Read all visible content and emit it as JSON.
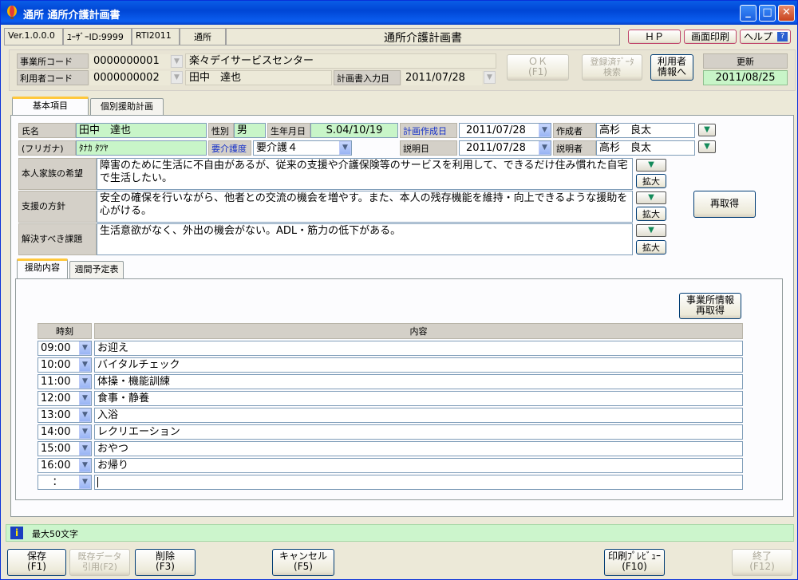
{
  "window": {
    "title": "通所 通所介護計画書"
  },
  "header": {
    "version": "Ver.1.0.0.0",
    "user_id": "ﾕｰｻﾞｰID:9999",
    "code": "RTI2011",
    "service": "通所",
    "screen_title": "通所介護計画書",
    "hp_label": "ＨＰ",
    "print_screen_label": "画面印刷",
    "help_label": "ヘルプ"
  },
  "office": {
    "office_code_label": "事業所コード",
    "office_code": "0000000001",
    "office_name": "楽々デイサービスセンター",
    "user_code_label": "利用者コード",
    "user_code": "0000000002",
    "user_name": "田中　達也",
    "plan_date_label": "計画書入力日",
    "plan_date": "2011/07/28",
    "ok_label": "ＯＫ",
    "ok_key": "(F1)",
    "registered_label": "登録済ﾃﾞｰﾀ",
    "registered_label2": "検索",
    "user_info_label": "利用者",
    "user_info_label2": "情報へ",
    "update_label": "更新",
    "update_date": "2011/08/25"
  },
  "tabs": {
    "basic": "基本項目",
    "individual": "個別援助計画"
  },
  "basic": {
    "name_label": "氏名",
    "name": "田中　達也",
    "kana_label": "(フリガナ)",
    "kana": "ﾀﾅｶ ﾀﾂﾔ",
    "sex_label": "性別",
    "sex": "男",
    "birth_label": "生年月日",
    "birth": "S.04/10/19",
    "care_level_label": "要介護度",
    "care_level": "要介護４",
    "plan_made_label": "計画作成日",
    "plan_made": "2011/07/28",
    "explain_date_label": "説明日",
    "explain_date": "2011/07/28",
    "author_label": "作成者",
    "author": "高杉　良太",
    "explainer_label": "説明者",
    "explainer": "高杉　良太",
    "wish_label": "本人家族の希望",
    "wish": "障害のために生活に不自由があるが、従来の支援や介護保険等のサービスを利用して、できるだけ住み慣れた自宅で生活したい。",
    "policy_label": "支援の方針",
    "policy": "安全の確保を行いながら、他者との交流の機会を増やす。また、本人の残存機能を維持・向上できるような援助を心がける。",
    "issue_label": "解決すべき課題",
    "issue": "生活意欲がなく、外出の機会がない。ADL・筋力の低下がある。",
    "expand_label": "拡大",
    "reacquire_label": "再取得"
  },
  "subtabs": {
    "assist": "援助内容",
    "weekly": "週間予定表"
  },
  "assist": {
    "office_reacquire_label": "事業所情報",
    "office_reacquire_label2": "再取得",
    "time_header": "時刻",
    "content_header": "内容",
    "rows": [
      {
        "time": "09:00",
        "content": "お迎え"
      },
      {
        "time": "10:00",
        "content": "バイタルチェック"
      },
      {
        "time": "11:00",
        "content": "体操・機能訓練"
      },
      {
        "time": "12:00",
        "content": "食事・静養"
      },
      {
        "time": "13:00",
        "content": "入浴"
      },
      {
        "time": "14:00",
        "content": "レクリエーション"
      },
      {
        "time": "15:00",
        "content": "おやつ"
      },
      {
        "time": "16:00",
        "content": "お帰り"
      }
    ],
    "empty_time": "："
  },
  "status": {
    "message": "最大50文字"
  },
  "footer": {
    "save": "保存",
    "save_key": "(F1)",
    "copy": "既存データ",
    "copy2": "引用(F2)",
    "delete": "削除",
    "delete_key": "(F3)",
    "cancel": "キャンセル",
    "cancel_key": "(F5)",
    "preview": "印刷ﾌﾟﾚﾋﾞｭｰ",
    "preview_key": "(F10)",
    "exit": "終了",
    "exit_key": "(F12)"
  },
  "colors": {
    "title_blue": "#0046d5",
    "field_green": "#c8f5c8",
    "status_green": "#ccf5cc",
    "input_yellow": "#fdf2c0"
  }
}
